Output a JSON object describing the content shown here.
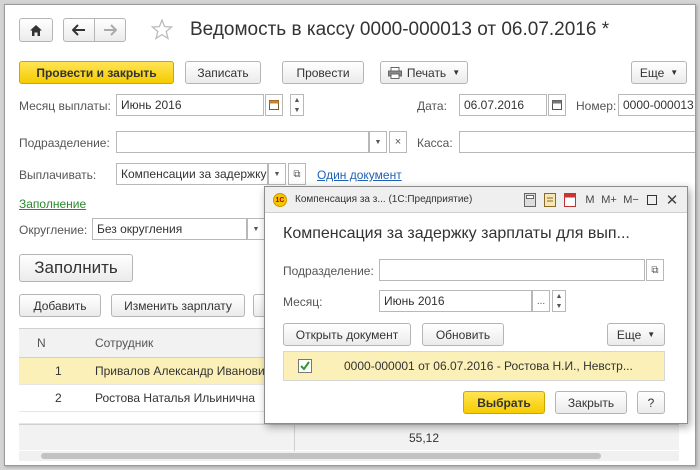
{
  "doc": {
    "title": "Ведомость в кассу 0000-000013 от 06.07.2016 *",
    "toolbar": {
      "post_close": "Провести и закрыть",
      "save": "Записать",
      "post": "Провести",
      "print": "Печать",
      "more": "Еще"
    },
    "fields": {
      "month_label": "Месяц выплаты:",
      "month_value": "Июнь 2016",
      "date_label": "Дата:",
      "date_value": "06.07.2016",
      "number_label": "Номер:",
      "number_value": "0000-000013",
      "dept_label": "Подразделение:",
      "dept_value": "",
      "cash_label": "Касса:",
      "cash_value": "",
      "pay_label": "Выплачивать:",
      "pay_value": "Компенсации за задержку",
      "one_doc_link": "Один документ",
      "fill_link": "Заполнение",
      "round_label": "Округление:",
      "round_value": "Без округления"
    },
    "fill_button": "Заполнить",
    "table_toolbar": {
      "add": "Добавить",
      "change_salary": "Изменить зарплату"
    },
    "table": {
      "columns": [
        "N",
        "Сотрудник"
      ],
      "rows": [
        {
          "n": "1",
          "employee": "Привалов Александр Иванович"
        },
        {
          "n": "2",
          "employee": "Ростова Наталья Ильинична"
        }
      ],
      "total": "55,12"
    }
  },
  "modal": {
    "window_title": "Компенсация за з...  (1С:Предприятие)",
    "heading": "Компенсация за задержку зарплаты для вып...",
    "dept_label": "Подразделение:",
    "dept_value": "",
    "month_label": "Месяц:",
    "month_value": "Июнь 2016",
    "open_doc": "Открыть документ",
    "refresh": "Обновить",
    "more": "Еще",
    "list_item": "0000-000001 от 06.07.2016 - Ростова Н.И., Невстр...",
    "list_item_checked": true,
    "select": "Выбрать",
    "close": "Закрыть",
    "help": "?",
    "title_controls": {
      "m": "M",
      "mplus": "M+",
      "mminus": "M−"
    }
  },
  "colors": {
    "accent_yellow": "#f5cc00",
    "link_blue": "#1f62b5",
    "link_green": "#2a8a2a",
    "row_highlight": "#fbf0b8"
  },
  "icons": [
    "home-icon",
    "back-arrow-icon",
    "forward-arrow-icon",
    "star-icon",
    "calendar-icon",
    "printer-icon",
    "dropdown-arrow-icon",
    "clear-icon",
    "open-icon",
    "checkbox-icon",
    "onec-logo-icon",
    "calculator-icon",
    "window-restore-icon",
    "close-icon"
  ]
}
